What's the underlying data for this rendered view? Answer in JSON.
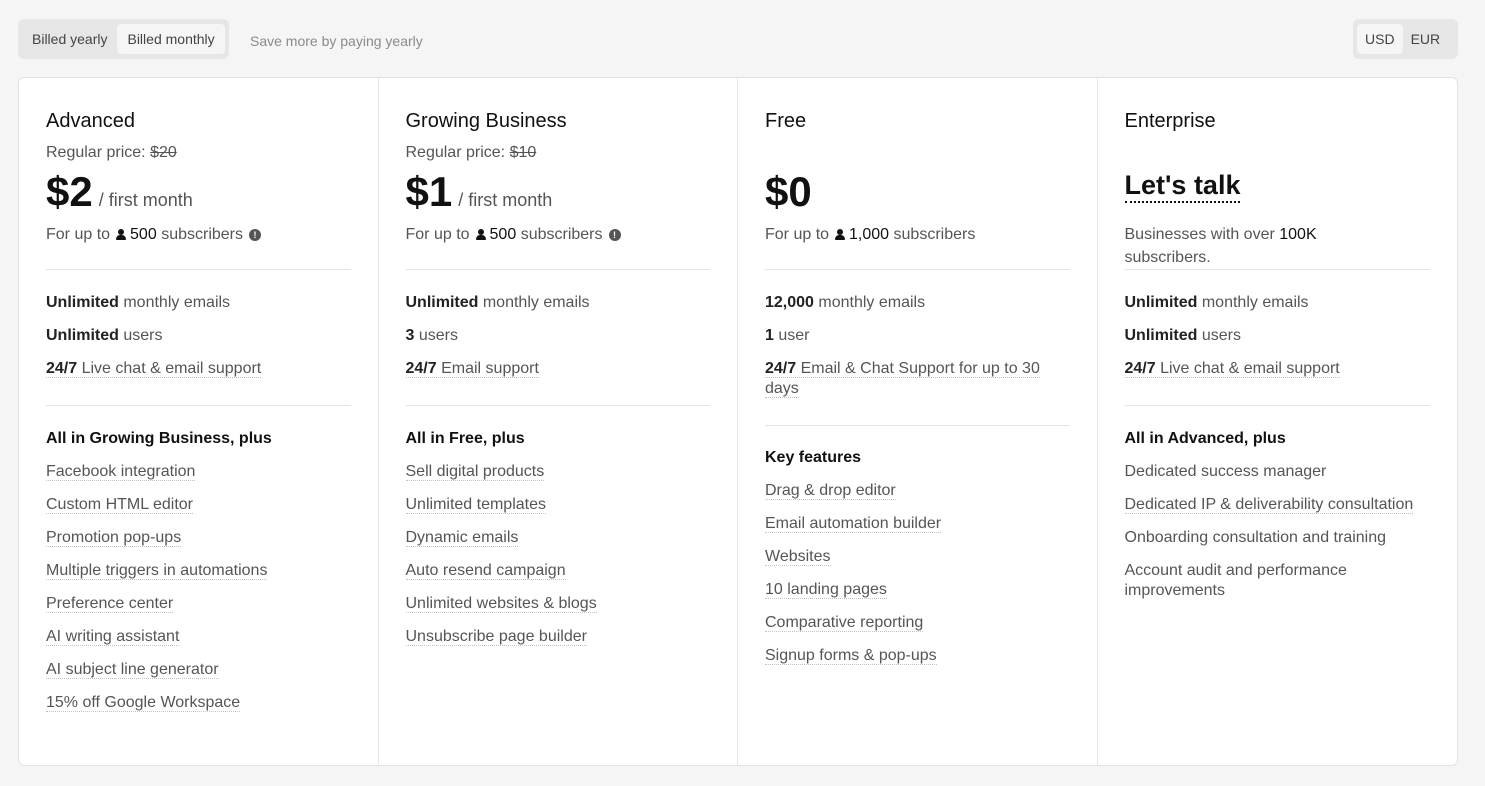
{
  "billing": {
    "yearly_label": "Billed yearly",
    "monthly_label": "Billed monthly",
    "save_note": "Save more by paying yearly"
  },
  "currency": {
    "usd": "USD",
    "eur": "EUR"
  },
  "plans": [
    {
      "name": "Advanced",
      "regular_label": "Regular price:",
      "regular_price": "$20",
      "price": "$2",
      "per": "/ first month",
      "sub_prefix": "For up to",
      "sub_count": "500",
      "sub_suffix": "subscribers",
      "limits": [
        {
          "strong": "Unlimited",
          "text": "monthly emails"
        },
        {
          "strong": "Unlimited",
          "text": "users"
        },
        {
          "strong": "24/7",
          "text": "Live chat & email support"
        }
      ],
      "features_head": "All in Growing Business, plus",
      "features": [
        "Facebook integration",
        "Custom HTML editor",
        "Promotion pop-ups",
        "Multiple triggers in automations",
        "Preference center",
        "AI writing assistant",
        "AI subject line generator",
        "15% off Google Workspace"
      ]
    },
    {
      "name": "Growing Business",
      "regular_label": "Regular price:",
      "regular_price": "$10",
      "price": "$1",
      "per": "/ first month",
      "sub_prefix": "For up to",
      "sub_count": "500",
      "sub_suffix": "subscribers",
      "limits": [
        {
          "strong": "Unlimited",
          "text": "monthly emails"
        },
        {
          "strong": "3",
          "text": "users"
        },
        {
          "strong": "24/7",
          "text": "Email support"
        }
      ],
      "features_head": "All in Free, plus",
      "features": [
        "Sell digital products",
        "Unlimited templates",
        "Dynamic emails",
        "Auto resend campaign",
        "Unlimited websites & blogs",
        "Unsubscribe page builder"
      ]
    },
    {
      "name": "Free",
      "price": "$0",
      "sub_prefix": "For up to",
      "sub_count": "1,000",
      "sub_suffix": "subscribers",
      "limits": [
        {
          "strong": "12,000",
          "text": "monthly emails"
        },
        {
          "strong": "1",
          "text": "user"
        },
        {
          "strong": "24/7",
          "text": "Email & Chat Support for up to 30 days"
        }
      ],
      "features_head": "Key features",
      "features": [
        "Drag & drop editor",
        "Email automation builder",
        "Websites",
        "10 landing pages",
        "Comparative reporting",
        "Signup forms & pop-ups"
      ]
    },
    {
      "name": "Enterprise",
      "cta": "Let's talk",
      "desc_prefix": "Businesses with over",
      "desc_strong": "100K",
      "desc_suffix": "subscribers.",
      "limits": [
        {
          "strong": "Unlimited",
          "text": "monthly emails"
        },
        {
          "strong": "Unlimited",
          "text": "users"
        },
        {
          "strong": "24/7",
          "text": "Live chat & email support"
        }
      ],
      "features_head": "All in Advanced, plus",
      "features": [
        "Dedicated success manager",
        "Dedicated IP & deliverability consultation",
        "Onboarding consultation and training",
        "Account audit and performance improvements"
      ]
    }
  ]
}
